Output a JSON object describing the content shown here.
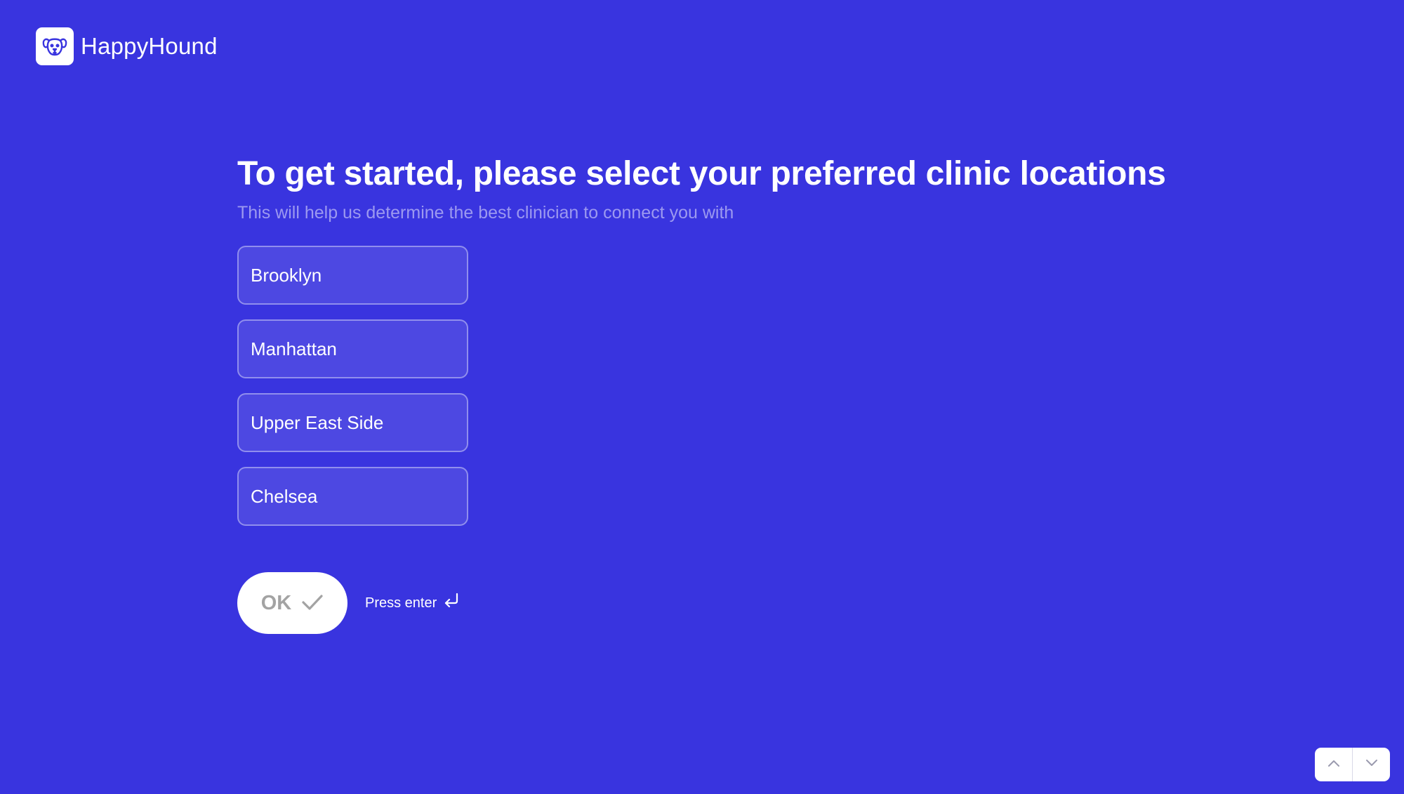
{
  "brand": {
    "name": "HappyHound",
    "logo_icon": "dog-face-icon"
  },
  "question": {
    "title": "To get started, please select your preferred clinic locations",
    "subtitle": "This will help us determine the best clinician to connect you with"
  },
  "options": [
    {
      "label": "Brooklyn"
    },
    {
      "label": "Manhattan"
    },
    {
      "label": "Upper East Side"
    },
    {
      "label": "Chelsea"
    }
  ],
  "actions": {
    "ok_label": "OK",
    "ok_icon": "check-icon",
    "hint": "Press enter",
    "hint_icon": "enter-return-icon"
  },
  "navigation": {
    "up_icon": "chevron-up-icon",
    "down_icon": "chevron-down-icon"
  },
  "colors": {
    "background": "#3934DF",
    "subtitle": "#9C99F0",
    "ok_text": "#A3A3A3",
    "logo": "#3934DF"
  }
}
